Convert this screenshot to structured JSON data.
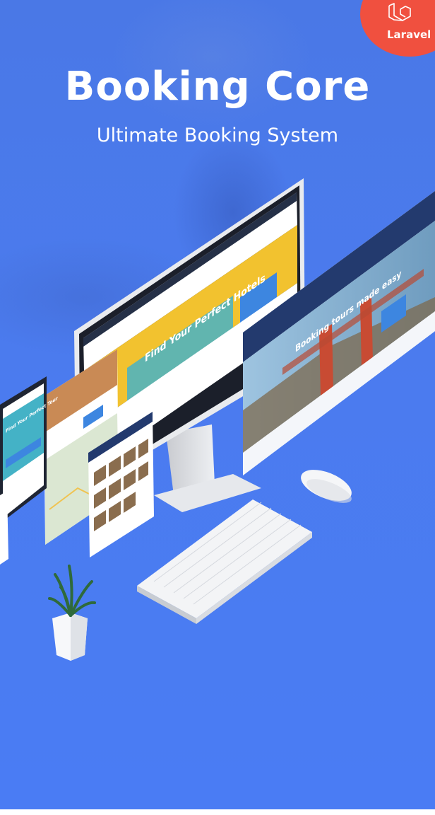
{
  "brand": {
    "title": "Booking Core",
    "subtitle": "Ultimate Booking System",
    "badge_label": "Laravel",
    "badge_color": "#f0503f",
    "background_color": "#4a7cf4"
  },
  "screens": {
    "monitor_headline": "Find Your Perfect Hotels",
    "wide_screen_headline": "Booking tours made easy",
    "tablet_headline": "Find Your Perfect Tour"
  },
  "icons": [
    "laravel-logo-icon",
    "plant-icon",
    "mouse-icon",
    "keyboard-icon"
  ]
}
